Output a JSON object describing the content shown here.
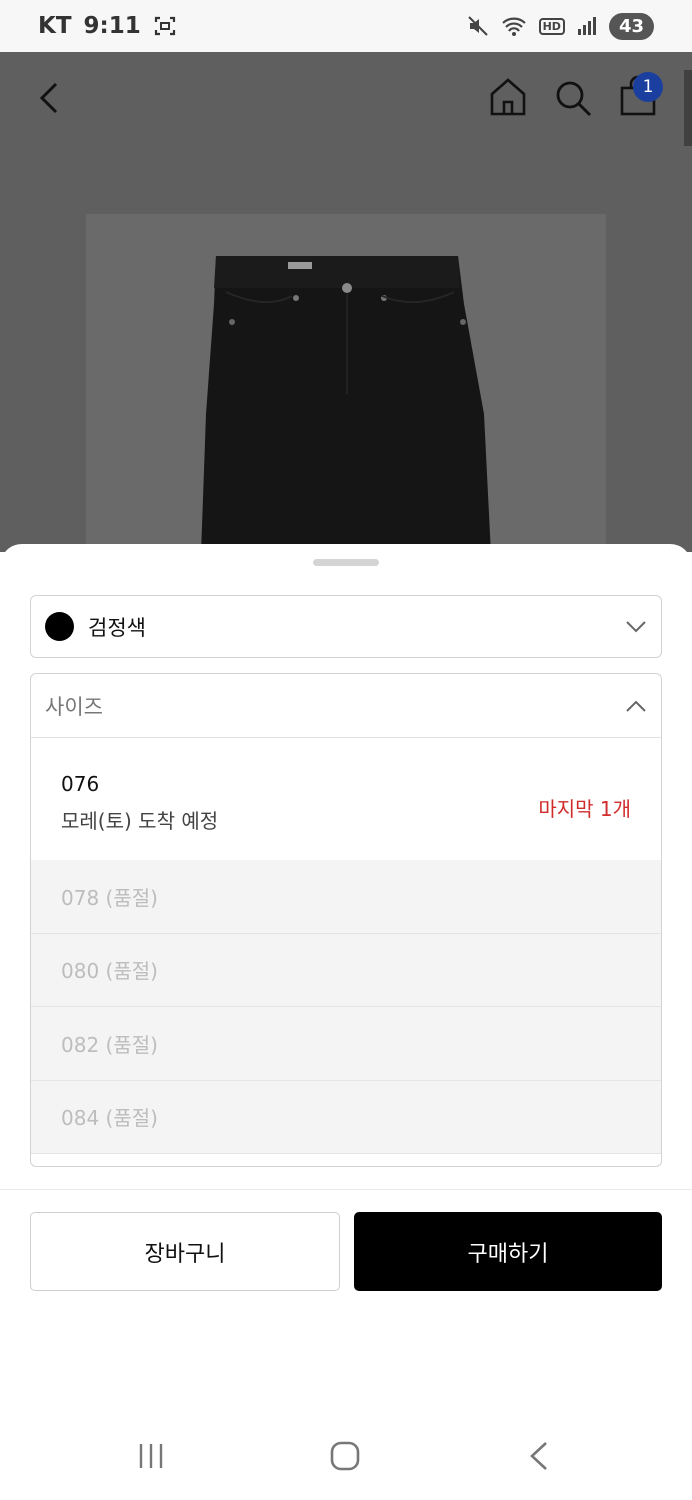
{
  "status_bar": {
    "carrier": "KT",
    "time": "9:11",
    "hd": "HD",
    "battery": "43"
  },
  "header": {
    "cart_count": "1"
  },
  "sheet": {
    "color_label": "검정색",
    "color_swatch": "#000000",
    "size_placeholder": "사이즈",
    "sizes": [
      {
        "code": "076",
        "note": "모레(토) 도착 예정",
        "stock": "마지막 1개"
      },
      {
        "label": "078 (품절)"
      },
      {
        "label": "080 (품절)"
      },
      {
        "label": "082 (품절)"
      },
      {
        "label": "084 (품절)"
      }
    ],
    "add_to_cart": "장바구니",
    "buy_now": "구매하기"
  },
  "colors": {
    "accent_badge": "#1b3f9e",
    "stock_warning": "#d12c2c"
  }
}
